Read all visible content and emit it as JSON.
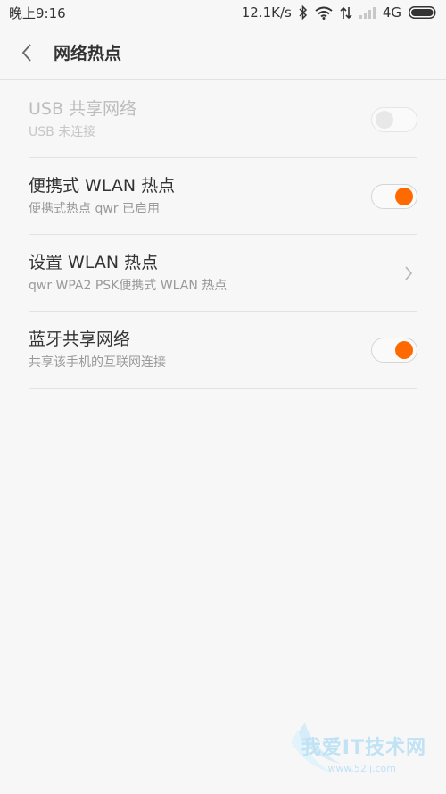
{
  "status_bar": {
    "time": "晚上9:16",
    "speed": "12.1K/s",
    "network": "4G"
  },
  "header": {
    "title": "网络热点"
  },
  "rows": [
    {
      "title": "USB 共享网络",
      "subtitle": "USB 未连接",
      "control": "toggle",
      "state": "off",
      "enabled": false
    },
    {
      "title": "便携式 WLAN 热点",
      "subtitle": "便携式热点 qwr 已启用",
      "control": "toggle",
      "state": "on",
      "enabled": true
    },
    {
      "title": "设置 WLAN 热点",
      "subtitle": "qwr WPA2 PSK便携式 WLAN 热点",
      "control": "chevron"
    },
    {
      "title": "蓝牙共享网络",
      "subtitle": "共享该手机的互联网连接",
      "control": "toggle",
      "state": "on",
      "enabled": true
    }
  ],
  "colors": {
    "accent": "#ff6a00",
    "background": "#f7f7f7",
    "divider": "#e3e3e3"
  },
  "watermark": {
    "text": "我爱IT技术网",
    "url": "www.52ij.com"
  }
}
